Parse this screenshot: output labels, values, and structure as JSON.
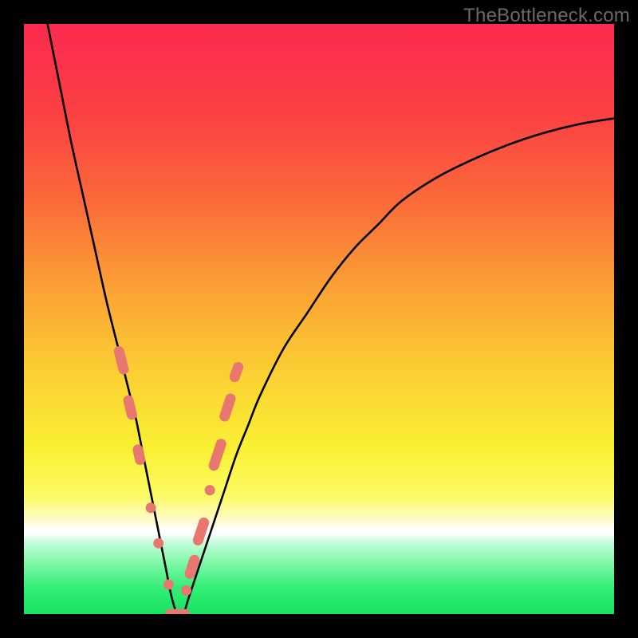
{
  "watermark": "TheBottleneck.com",
  "colors": {
    "frame": "#000000",
    "watermark": "#6a6a6a",
    "curve_stroke": "#000000",
    "marker_fill": "#e8786f",
    "marker_stroke": "#d05f57",
    "gradient_stops": [
      {
        "offset": 0.0,
        "color": "#fb2a4e"
      },
      {
        "offset": 0.15,
        "color": "#fb4043"
      },
      {
        "offset": 0.3,
        "color": "#fb6a3a"
      },
      {
        "offset": 0.45,
        "color": "#fba235"
      },
      {
        "offset": 0.6,
        "color": "#fbd233"
      },
      {
        "offset": 0.72,
        "color": "#faf033"
      },
      {
        "offset": 0.8,
        "color": "#fcfb66"
      },
      {
        "offset": 0.845,
        "color": "#fffbd5"
      },
      {
        "offset": 0.855,
        "color": "#ffffff"
      },
      {
        "offset": 0.865,
        "color": "#ffffff"
      },
      {
        "offset": 0.875,
        "color": "#cffde4"
      },
      {
        "offset": 0.905,
        "color": "#8ef9b2"
      },
      {
        "offset": 0.955,
        "color": "#34ee77"
      },
      {
        "offset": 1.0,
        "color": "#17e264"
      }
    ]
  },
  "chart_data": {
    "type": "line",
    "title": "",
    "xlabel": "",
    "ylabel": "",
    "xlim": [
      0,
      100
    ],
    "ylim": [
      0,
      100
    ],
    "grid": false,
    "series": [
      {
        "name": "curve",
        "x": [
          4,
          6,
          8,
          10,
          12,
          14,
          16,
          17,
          18,
          19,
          20,
          21,
          22,
          23,
          24,
          25,
          26,
          27,
          28,
          30,
          32,
          34,
          36,
          38,
          40,
          44,
          48,
          52,
          56,
          60,
          64,
          70,
          76,
          82,
          88,
          94,
          100
        ],
        "y": [
          100,
          90,
          80,
          71,
          62,
          53,
          45,
          41,
          37,
          33,
          28,
          23,
          18,
          13,
          8,
          3,
          0,
          0,
          3,
          9,
          15,
          21,
          27,
          32,
          37,
          45,
          51,
          57,
          62,
          66,
          70,
          74,
          77,
          79.5,
          81.5,
          83,
          84
        ]
      }
    ],
    "markers": [
      {
        "x": 16.5,
        "y": 43,
        "shape": "pill",
        "len": 7
      },
      {
        "x": 18.0,
        "y": 35,
        "shape": "pill",
        "len": 6
      },
      {
        "x": 19.5,
        "y": 27,
        "shape": "pill",
        "len": 5
      },
      {
        "x": 21.5,
        "y": 18,
        "shape": "dot"
      },
      {
        "x": 22.8,
        "y": 12,
        "shape": "dot"
      },
      {
        "x": 24.5,
        "y": 5,
        "shape": "dot"
      },
      {
        "x": 26.0,
        "y": 0,
        "shape": "pill",
        "len": 6,
        "horizontal": true
      },
      {
        "x": 27.5,
        "y": 4,
        "shape": "dot"
      },
      {
        "x": 28.5,
        "y": 8,
        "shape": "pill",
        "len": 6
      },
      {
        "x": 30.0,
        "y": 14,
        "shape": "pill",
        "len": 7
      },
      {
        "x": 31.5,
        "y": 21,
        "shape": "dot"
      },
      {
        "x": 32.8,
        "y": 27,
        "shape": "pill",
        "len": 8
      },
      {
        "x": 34.5,
        "y": 35,
        "shape": "pill",
        "len": 7
      },
      {
        "x": 36.0,
        "y": 41,
        "shape": "pill",
        "len": 5
      }
    ]
  }
}
